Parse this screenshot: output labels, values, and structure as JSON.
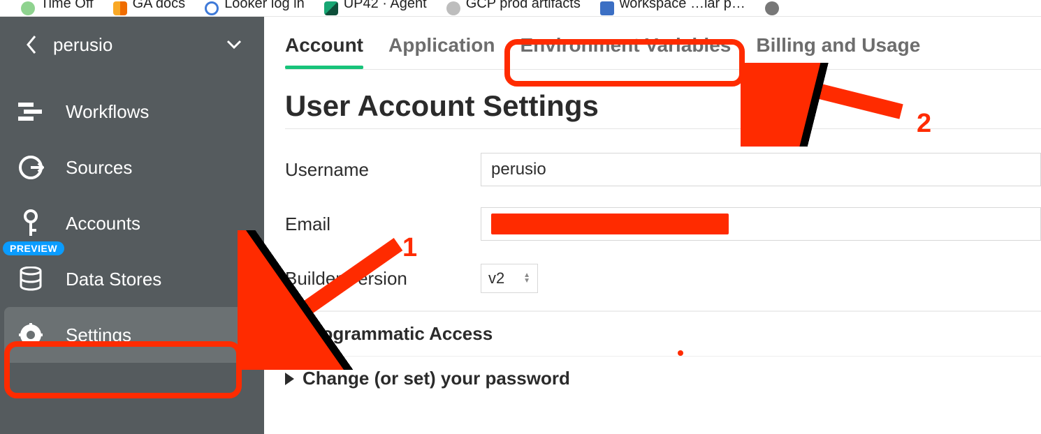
{
  "bookmarks": {
    "items": [
      {
        "label": "Time Off"
      },
      {
        "label": "GA docs"
      },
      {
        "label": "Looker log in"
      },
      {
        "label": "UP42 · Agent"
      },
      {
        "label": "GCP prod artifacts"
      },
      {
        "label": "workspace …lar p…"
      }
    ]
  },
  "sidebar": {
    "account_name": "perusio",
    "items": [
      {
        "id": "workflows",
        "label": "Workflows"
      },
      {
        "id": "sources",
        "label": "Sources"
      },
      {
        "id": "accounts",
        "label": "Accounts"
      },
      {
        "id": "datastores",
        "label": "Data Stores",
        "badge": "PREVIEW"
      },
      {
        "id": "settings",
        "label": "Settings",
        "active": true
      }
    ]
  },
  "tabs": {
    "items": [
      {
        "id": "account",
        "label": "Account",
        "active": true
      },
      {
        "id": "application",
        "label": "Application"
      },
      {
        "id": "env",
        "label": "Environment Variables"
      },
      {
        "id": "billing",
        "label": "Billing and Usage"
      }
    ]
  },
  "page": {
    "title": "User Account Settings",
    "fields": {
      "username_label": "Username",
      "username_value": "perusio",
      "email_label": "Email",
      "builder_label": "Builder Version",
      "builder_value": "v2"
    },
    "disclosures": {
      "programmatic": "Programmatic Access",
      "password": "Change (or set) your password"
    }
  },
  "annotations": {
    "n1": "1",
    "n2": "2"
  }
}
